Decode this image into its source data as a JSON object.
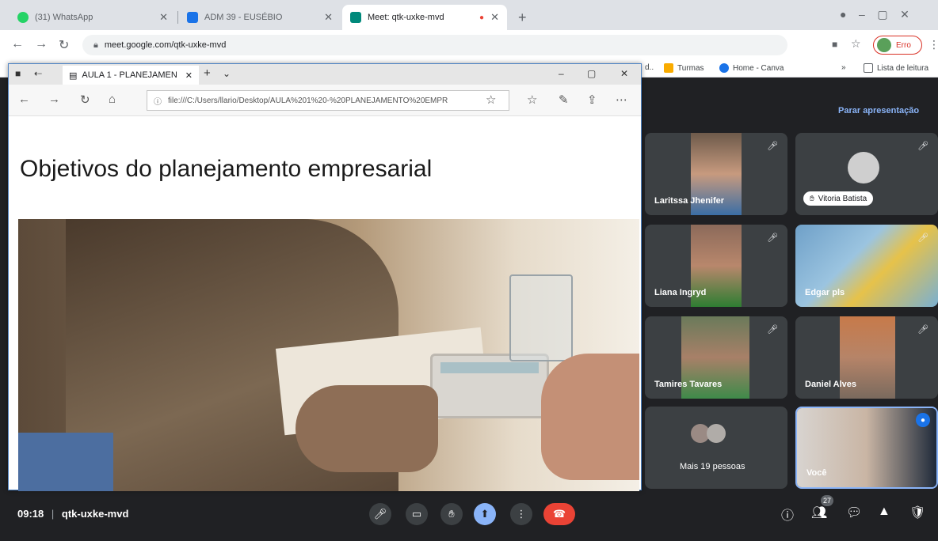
{
  "browser": {
    "tabs": [
      {
        "label": "(31) WhatsApp",
        "color": "#25d366"
      },
      {
        "label": "ADM 39 - EUSÉBIO",
        "color": "#1a73e8"
      },
      {
        "label": "Meet: qtk-uxke-mvd",
        "color": "#00897b"
      }
    ],
    "new_tab": "+",
    "url": "meet.google.com/qtk-uxke-mvd",
    "profile_label": "Erro",
    "bookmarks": [
      "Turmas",
      "Home - Canva",
      "Lista de leitura"
    ],
    "bookmark_prefix": "d.."
  },
  "edge": {
    "tab_title": "AULA 1 - PLANEJAMEN",
    "url": "file:///C:/Users/llario/Desktop/AULA%201%20-%20PLANEJAMENTO%20EMPR",
    "slide_title": "Objetivos do planejamento empresarial"
  },
  "meet": {
    "stop_presenting": "Parar apresentação",
    "meeting_code": "qtk-uxke-mvd",
    "time": "09:18",
    "separator": "|",
    "participants_count": "27",
    "participants": [
      {
        "name": "Laritssa Jhenifer"
      },
      {
        "name": "Vitoria Batista"
      },
      {
        "name": "Liana Ingryd"
      },
      {
        "name": "Edgar pls"
      },
      {
        "name": "Tamires Tavares"
      },
      {
        "name": "Daniel Alves"
      },
      {
        "name": "Mais 19 pessoas"
      },
      {
        "name": "Você"
      }
    ]
  },
  "colors": {
    "accent": "#8ab4f8",
    "hangup": "#ea4335",
    "tile": "#3c4043"
  }
}
